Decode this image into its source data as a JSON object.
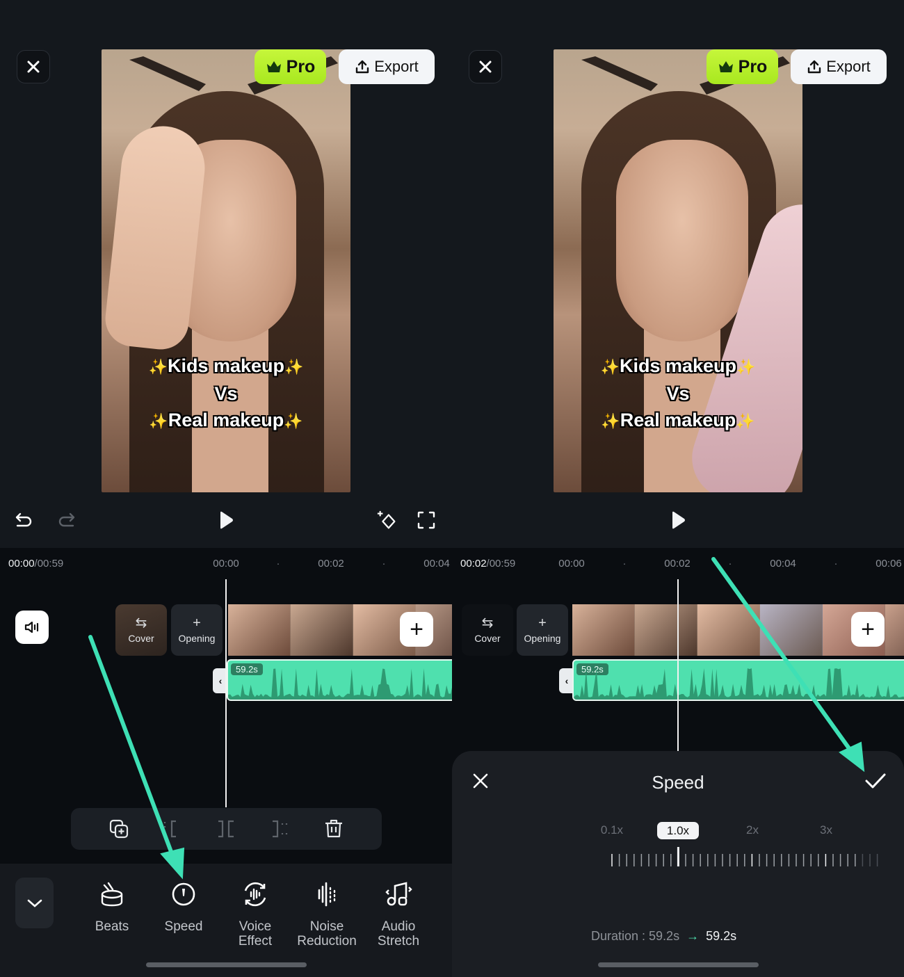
{
  "left_screen": {
    "close_icon": "close-icon",
    "pro_label": "Pro",
    "export_label": "Export",
    "caption": {
      "line1": "Kids makeup",
      "line2": "Vs",
      "line3": "Real makeup",
      "spark": "✨"
    },
    "controls": {
      "undo_icon": "undo-icon",
      "redo_icon": "redo-icon",
      "play_icon": "play-icon",
      "keyframe_icon": "add-keyframe-icon",
      "fullscreen_icon": "fullscreen-icon"
    },
    "timeline": {
      "current_time": "00:00",
      "total_time": "/00:59",
      "ticks": [
        "00:00",
        "00:02",
        "00:04"
      ],
      "cover_label": "Cover",
      "opening_label": "Opening",
      "audio_duration": "59.2s"
    },
    "edit_tools": [
      "copy-add-icon",
      "trim-start-icon",
      "split-icon",
      "trim-end-icon",
      "delete-icon"
    ],
    "bottom_tools": [
      {
        "label": "Beats",
        "icon": "beats-icon"
      },
      {
        "label": "Speed",
        "icon": "speed-icon"
      },
      {
        "label": "Voice\nEffect",
        "icon": "voice-effect-icon"
      },
      {
        "label": "Noise\nReduction",
        "icon": "noise-reduction-icon"
      },
      {
        "label": "Audio\nStretch",
        "icon": "audio-stretch-icon"
      }
    ]
  },
  "right_screen": {
    "pro_label": "Pro",
    "export_label": "Export",
    "caption": {
      "line1": "Kids makeup",
      "line2": "Vs",
      "line3": "Real makeup",
      "spark": "✨"
    },
    "timeline": {
      "current_time": "00:02",
      "total_time": "/00:59",
      "ticks": [
        "00:00",
        "00:02",
        "00:04",
        "00:06"
      ],
      "cover_label": "Cover",
      "opening_label": "Opening",
      "audio_duration": "59.2s"
    },
    "speed_sheet": {
      "title": "Speed",
      "options": [
        "0.1x",
        "1.0x",
        "2x",
        "3x"
      ],
      "selected": "1.0x",
      "selected_value": 1.0,
      "duration_label": "Duration : 59.2s",
      "duration_arrow": "→",
      "new_duration": "59.2s"
    }
  },
  "colors": {
    "accent_green": "#4fe0ae",
    "pro_green": "#b5ef2a",
    "annotation_arrow": "#3ee0b5"
  }
}
